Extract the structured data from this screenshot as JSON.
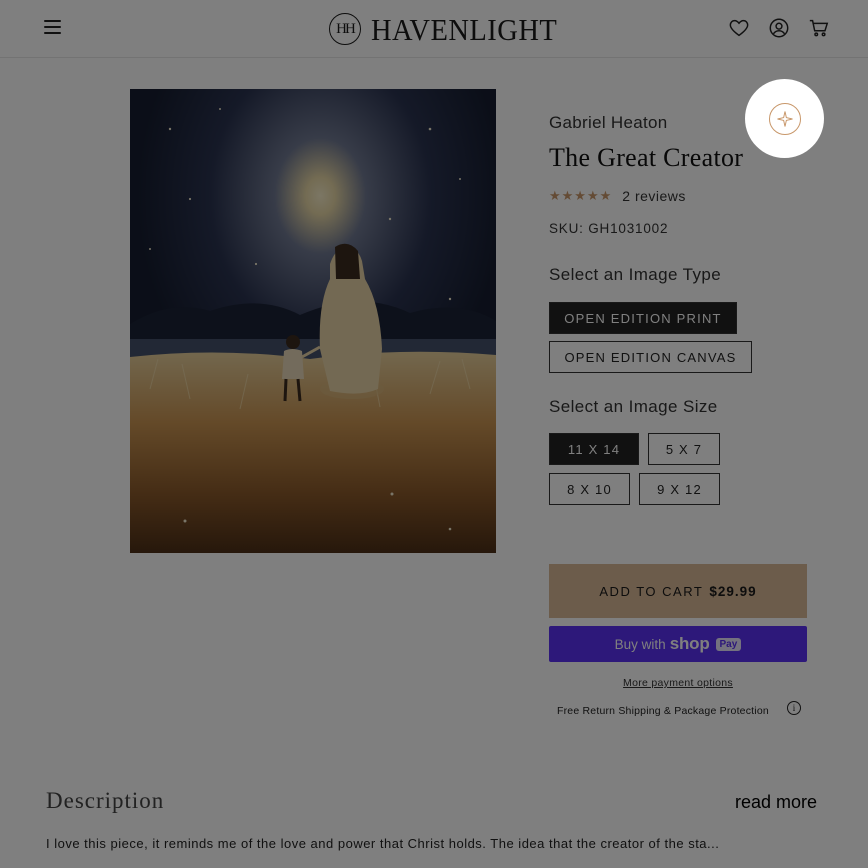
{
  "header": {
    "logo_mark": "HH",
    "logo_text": "HAVENLIGHT",
    "icons": [
      "menu-icon",
      "heart-icon",
      "account-icon",
      "cart-icon"
    ]
  },
  "product": {
    "artist": "Gabriel Heaton",
    "title": "The Great Creator",
    "rating_stars": "★★★★★",
    "reviews": "2 reviews",
    "sku": "SKU:  GH1031002",
    "image_type_label": "Select an Image Type",
    "image_types": [
      "OPEN EDITION PRINT",
      "OPEN EDITION CANVAS"
    ],
    "image_type_selected": "OPEN EDITION PRINT",
    "image_size_label": "Select an Image Size",
    "image_sizes": [
      "11 X 14",
      "5 X 7",
      "8 X 10",
      "9 X 12"
    ],
    "image_size_selected": "11 X 14",
    "add_to_cart_label": "ADD TO CART",
    "price": "$29.99",
    "shop_pay": {
      "prefix": "Buy with",
      "brand": "shop",
      "badge": "Pay"
    },
    "more_payment": "More payment options",
    "free_return": "Free Return Shipping & Package Protection",
    "info_icon": "i"
  },
  "description": {
    "heading": "Description",
    "read_more": "read more",
    "text": "I love this piece, it reminds me of the love and power that Christ holds. The idea that the creator of the sta..."
  },
  "colors": {
    "accent": "#c8976a",
    "add_to_cart_bg": "#d8b896",
    "shop_pay_bg": "#5a31f4",
    "selected_option_bg": "#222222"
  },
  "spotlight_icon": "sparkle-icon"
}
